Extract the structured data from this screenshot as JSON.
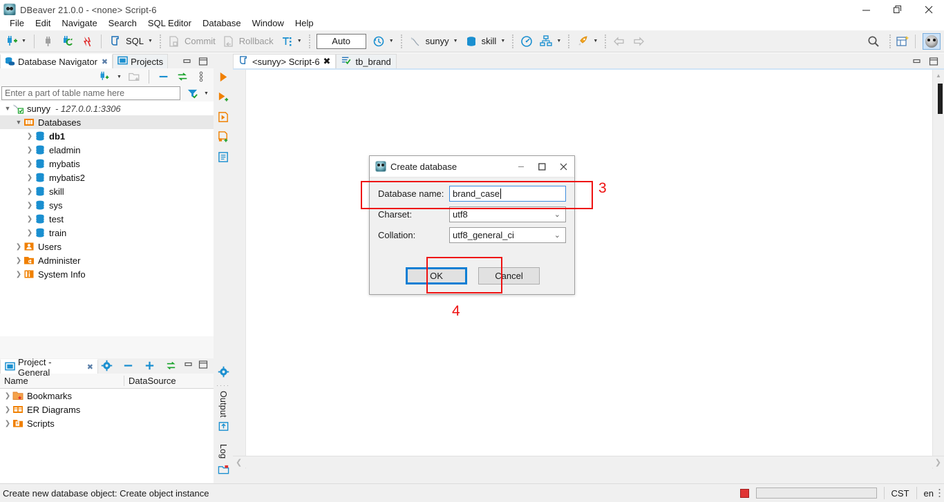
{
  "window": {
    "title": "DBeaver 21.0.0 - <none> Script-6",
    "app_icon": "dbeaver-beaver-icon",
    "minimize": "minimize-icon",
    "maximize": "restore-icon",
    "close": "close-icon"
  },
  "menubar": {
    "items": [
      "File",
      "Edit",
      "Navigate",
      "Search",
      "SQL Editor",
      "Database",
      "Window",
      "Help"
    ]
  },
  "toolbar": {
    "new_connection": "new-connection-icon",
    "disconnect": "disconnect-icon",
    "refresh_connection": "refresh-connection-icon",
    "disconnect_all": "disconnect-all-icon",
    "sql_label": "SQL",
    "commit_label": "Commit",
    "rollback_label": "Rollback",
    "transaction_mode_icon": "transaction-mode-icon",
    "auto_label": "Auto",
    "history_icon": "history-icon",
    "connection_name": "sunyy",
    "database_name": "skill",
    "dashboard_icon": "dashboard-icon",
    "er_diagram_icon": "er-diagram-icon",
    "rocket_icon": "rocket-icon",
    "back_icon": "back-arrow-icon",
    "forward_icon": "forward-arrow-icon",
    "search_icon": "search-icon",
    "new_object_icon": "new-object-icon",
    "avatar_icon": "user-avatar-icon"
  },
  "navigator": {
    "tabs": [
      {
        "label": "Database Navigator",
        "icon": "database-navigator-icon",
        "active": true,
        "closeable": true
      },
      {
        "label": "Projects",
        "icon": "projects-folder-icon",
        "active": false,
        "closeable": false
      }
    ],
    "minimize_icon": "minimize-panel-icon",
    "maximize_icon": "maximize-panel-icon",
    "panel_tools": [
      "new-connection-icon",
      "chevron-down-icon",
      "new-folder-icon",
      "collapse-all-icon",
      "link-editor-icon",
      "view-menu-icon"
    ],
    "filter": {
      "placeholder": "Enter a part of table name here",
      "value": "",
      "filter_icon": "filter-funnel-icon",
      "dropdown_icon": "chevron-down-icon"
    },
    "tree": [
      {
        "label": "sunyy",
        "suffix": "- 127.0.0.1:3306",
        "icon": "connection-icon",
        "indent": 0,
        "twist": "expanded",
        "bold": false,
        "selected": false
      },
      {
        "label": "Databases",
        "suffix": "",
        "icon": "databases-folder-icon",
        "indent": 1,
        "twist": "expanded",
        "bold": false,
        "selected": true
      },
      {
        "label": "db1",
        "suffix": "",
        "icon": "database-icon",
        "indent": 2,
        "twist": "collapsed",
        "bold": true,
        "selected": false
      },
      {
        "label": "eladmin",
        "suffix": "",
        "icon": "database-icon",
        "indent": 2,
        "twist": "collapsed",
        "bold": false,
        "selected": false
      },
      {
        "label": "mybatis",
        "suffix": "",
        "icon": "database-icon",
        "indent": 2,
        "twist": "collapsed",
        "bold": false,
        "selected": false
      },
      {
        "label": "mybatis2",
        "suffix": "",
        "icon": "database-icon",
        "indent": 2,
        "twist": "collapsed",
        "bold": false,
        "selected": false
      },
      {
        "label": "skill",
        "suffix": "",
        "icon": "database-icon",
        "indent": 2,
        "twist": "collapsed",
        "bold": false,
        "selected": false
      },
      {
        "label": "sys",
        "suffix": "",
        "icon": "database-icon",
        "indent": 2,
        "twist": "collapsed",
        "bold": false,
        "selected": false
      },
      {
        "label": "test",
        "suffix": "",
        "icon": "database-icon",
        "indent": 2,
        "twist": "collapsed",
        "bold": false,
        "selected": false
      },
      {
        "label": "train",
        "suffix": "",
        "icon": "database-icon",
        "indent": 2,
        "twist": "collapsed",
        "bold": false,
        "selected": false
      },
      {
        "label": "Users",
        "suffix": "",
        "icon": "users-icon",
        "indent": 1,
        "twist": "collapsed",
        "bold": false,
        "selected": false
      },
      {
        "label": "Administer",
        "suffix": "",
        "icon": "administer-folder-icon",
        "indent": 1,
        "twist": "collapsed",
        "bold": false,
        "selected": false
      },
      {
        "label": "System Info",
        "suffix": "",
        "icon": "system-info-icon",
        "indent": 1,
        "twist": "collapsed",
        "bold": false,
        "selected": false
      }
    ]
  },
  "project_panel": {
    "tab_label": "Project - General",
    "tab_icon": "project-icon",
    "tools": [
      "gear-icon",
      "minimize-icon",
      "add-icon",
      "link-editor-icon"
    ],
    "minimize_icon": "minimize-panel-icon",
    "maximize_icon": "maximize-panel-icon",
    "columns": [
      "Name",
      "DataSource"
    ],
    "rows": [
      {
        "label": "Bookmarks",
        "icon": "bookmarks-folder-icon",
        "datasource": ""
      },
      {
        "label": "ER Diagrams",
        "icon": "er-diagrams-folder-icon",
        "datasource": ""
      },
      {
        "label": "Scripts",
        "icon": "scripts-folder-icon",
        "datasource": ""
      }
    ]
  },
  "vertical_strip": {
    "top_icons": [
      "execute-statement-icon",
      "execute-new-tab-icon",
      "execute-script-icon",
      "execute-script-new-tab-icon",
      "explain-plan-icon"
    ],
    "bottom_icons": [
      "gear-icon",
      "output-upload-icon",
      "log-folder-icon"
    ],
    "output_label": "Output",
    "log_label": "Log"
  },
  "editor": {
    "tabs": [
      {
        "label": "<sunyy> Script-6",
        "icon": "sql-editor-icon",
        "active": true,
        "closeable": true
      },
      {
        "label": "tb_brand",
        "icon": "table-check-icon",
        "active": false,
        "closeable": false
      }
    ],
    "minimize_icon": "minimize-panel-icon",
    "maximize_icon": "maximize-panel-icon",
    "content": "",
    "scroll_left_icon": "scroll-left-icon",
    "scroll_right_icon": "scroll-right-icon",
    "scroll_up_icon": "scroll-up-icon",
    "scroll_down_icon": "scroll-down-icon"
  },
  "dialog": {
    "title": "Create database",
    "icon": "dbeaver-beaver-icon",
    "minimize": "minimize-icon",
    "maximize": "maximize-icon",
    "close": "close-icon",
    "fields": [
      {
        "label": "Database name:",
        "value": "brand_case",
        "type": "text",
        "focused": true
      },
      {
        "label": "Charset:",
        "value": "utf8",
        "type": "select",
        "focused": false
      },
      {
        "label": "Collation:",
        "value": "utf8_general_ci",
        "type": "select",
        "focused": false
      }
    ],
    "ok_label": "OK",
    "cancel_label": "Cancel"
  },
  "annotations": [
    {
      "number": "3",
      "target": "database-name-row"
    },
    {
      "number": "4",
      "target": "ok-button"
    }
  ],
  "statusbar": {
    "message": "Create new database object: Create object instance",
    "stop_icon": "stop-icon",
    "progress_value": "",
    "timezone": "CST",
    "language": "en",
    "menu_icon": "more-options-icon"
  },
  "colors": {
    "accent_blue": "#2196d4",
    "annotation_red": "#ee1111",
    "folder_orange": "#f08000",
    "toolbar_bg": "#f0f0f0",
    "focus_blue": "#0f7fd4"
  }
}
